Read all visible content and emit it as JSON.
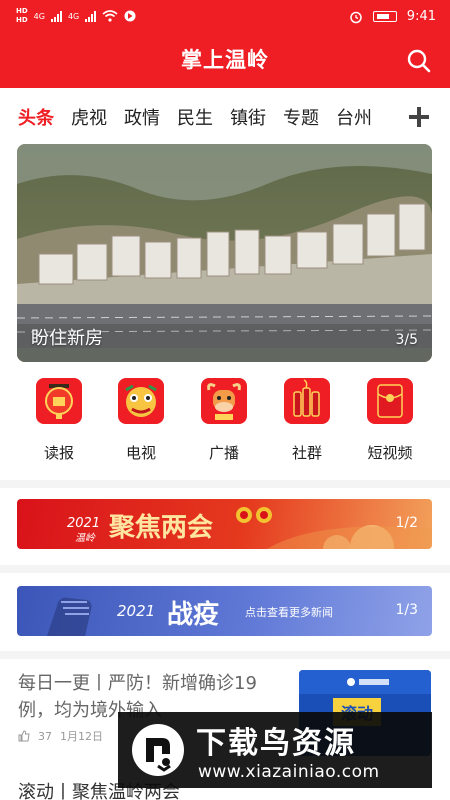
{
  "status": {
    "hd1": "HD",
    "hd2": "HD",
    "net1": "4G",
    "net2": "4G",
    "time": "9:41"
  },
  "header": {
    "title": "掌上温岭"
  },
  "tabs": [
    {
      "label": "头条",
      "active": true
    },
    {
      "label": "虎视"
    },
    {
      "label": "政情"
    },
    {
      "label": "民生"
    },
    {
      "label": "镇街"
    },
    {
      "label": "专题"
    },
    {
      "label": "台州"
    }
  ],
  "carousel": {
    "caption": "盼住新房",
    "index": "3/5"
  },
  "quick_links": [
    {
      "label": "读报",
      "icon": "lantern-icon"
    },
    {
      "label": "电视",
      "icon": "lion-dance-icon"
    },
    {
      "label": "广播",
      "icon": "ox-icon"
    },
    {
      "label": "社群",
      "icon": "firecracker-icon"
    },
    {
      "label": "短视频",
      "icon": "red-envelope-icon"
    }
  ],
  "banners": [
    {
      "year": "2021",
      "prefix": "温岭",
      "headline": "聚焦两会",
      "index": "1/2"
    },
    {
      "year": "2021",
      "headline": "战疫",
      "subtitle": "点击查看更多新闻",
      "index": "1/3"
    }
  ],
  "news": [
    {
      "title": "每日一更丨严防！新增确诊19例，均为境外输入",
      "likes": "37",
      "date": "1月12日",
      "thumb_tag": "滚动"
    },
    {
      "title": "滚动丨聚焦温岭两会"
    }
  ],
  "watermark": {
    "title": "下载鸟资源",
    "url": "www.xiazainiao.com"
  },
  "colors": {
    "brand": "#ef1e24",
    "banner_red": "#d9121a",
    "banner_blue": "#3b56b8"
  }
}
